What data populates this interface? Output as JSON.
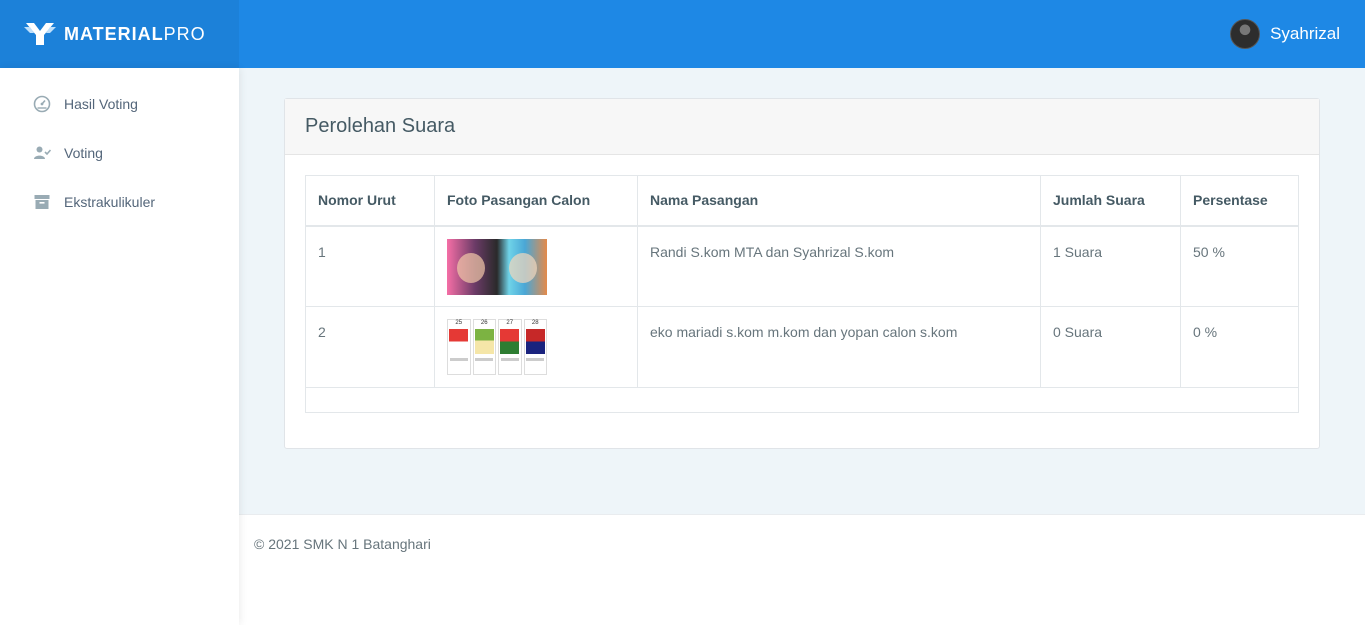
{
  "brand": {
    "logo_icon": "materialpro-logo-icon",
    "name_bold": "MATERIAL",
    "name_light": "PRO"
  },
  "user": {
    "name": "Syahrizal",
    "avatar_icon": "user-avatar"
  },
  "sidebar": {
    "items": [
      {
        "label": "Hasil Voting",
        "icon": "dashboard-icon"
      },
      {
        "label": "Voting",
        "icon": "user-check-icon"
      },
      {
        "label": "Ekstrakulikuler",
        "icon": "archive-icon"
      }
    ]
  },
  "card": {
    "title": "Perolehan Suara",
    "columns": [
      "Nomor Urut",
      "Foto Pasangan Calon",
      "Nama Pasangan",
      "Jumlah Suara",
      "Persentase"
    ],
    "rows": [
      {
        "nomor": "1",
        "nama": "Randi S.kom MTA dan Syahrizal S.kom",
        "suara": "1 Suara",
        "persen": "50 %"
      },
      {
        "nomor": "2",
        "nama": "eko mariadi s.kom m.kom dan yopan calon s.kom",
        "suara": "0 Suara",
        "persen": "0 %"
      }
    ],
    "poster_numbers": [
      "25",
      "26",
      "27",
      "28"
    ]
  },
  "footer": {
    "copyright": "© 2021 SMK N 1 Batanghari"
  },
  "colors": {
    "topbar": "#1e88e5",
    "background": "#eef5f9",
    "sidebar": "#ffffff"
  }
}
